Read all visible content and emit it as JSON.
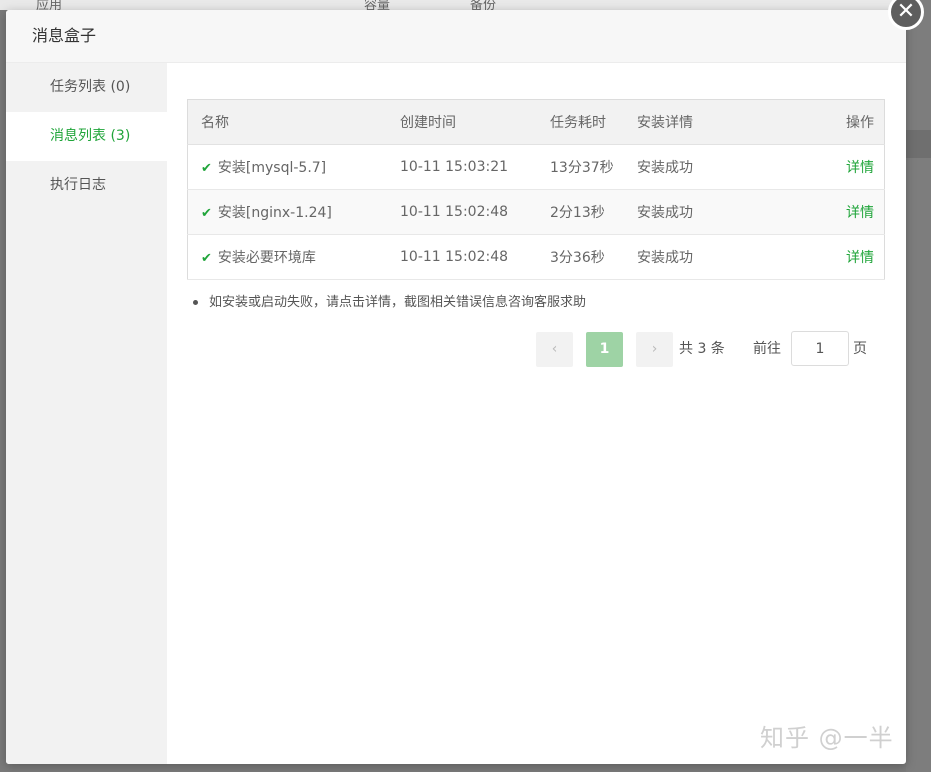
{
  "background": {
    "left_text": "应用",
    "mid_text1": "容量",
    "mid_text2": "备份"
  },
  "modal": {
    "title": "消息盒子",
    "close_label": "✕"
  },
  "sidebar": {
    "items": [
      {
        "label": "任务列表 (0)"
      },
      {
        "label": "消息列表 (3)"
      },
      {
        "label": "执行日志"
      }
    ]
  },
  "table": {
    "headers": {
      "name": "名称",
      "created": "创建时间",
      "duration": "任务耗时",
      "detail": "安装详情",
      "op": "操作"
    },
    "rows": [
      {
        "name": "安装[mysql-5.7]",
        "created": "10-11 15:03:21",
        "duration": "13分37秒",
        "status": "安装成功",
        "op": "详情"
      },
      {
        "name": "安装[nginx-1.24]",
        "created": "10-11 15:02:48",
        "duration": "2分13秒",
        "status": "安装成功",
        "op": "详情"
      },
      {
        "name": "安装必要环境库",
        "created": "10-11 15:02:48",
        "duration": "3分36秒",
        "status": "安装成功",
        "op": "详情"
      }
    ]
  },
  "tip": "如安装或启动失败，请点击详情，截图相关错误信息咨询客服求助",
  "pagination": {
    "prev": "‹",
    "current": "1",
    "next": "›",
    "total_text": "共 3 条",
    "goto_label": "前往",
    "goto_value": "1",
    "page_suffix": "页"
  },
  "watermark": "知乎 @一半",
  "colors": {
    "accent": "#20a53a"
  }
}
